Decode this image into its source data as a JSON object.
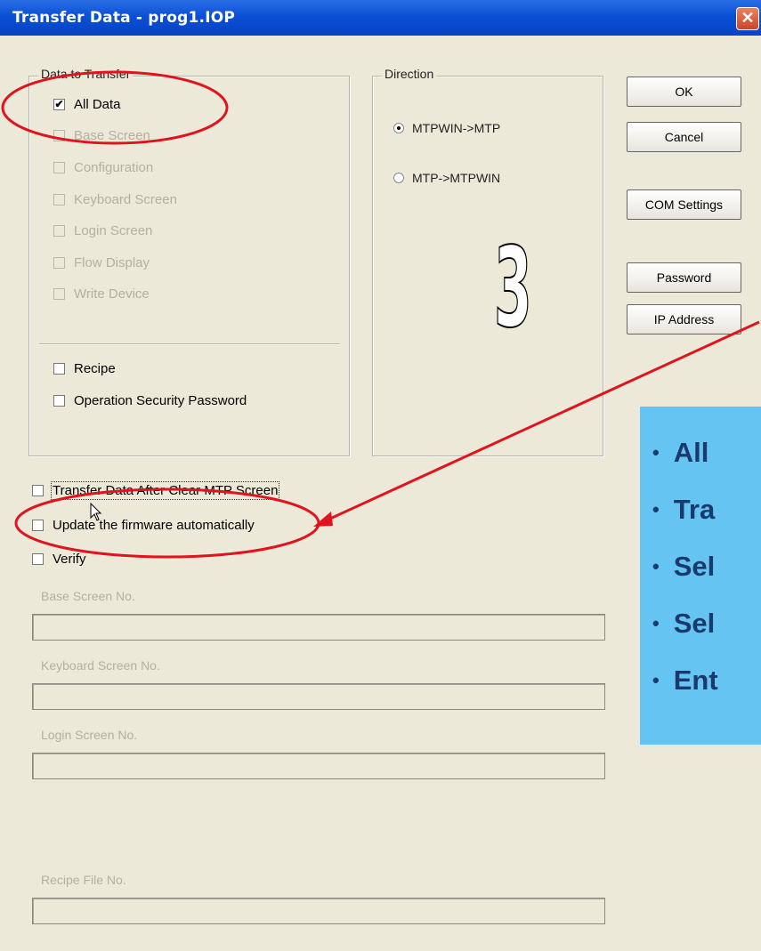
{
  "window": {
    "title": "Transfer Data - prog1.IOP",
    "close_icon": "close-icon"
  },
  "data_to_transfer": {
    "legend": "Data to Transfer",
    "items": [
      {
        "label": "All Data",
        "checked": true,
        "enabled": true
      },
      {
        "label": "Base Screen",
        "checked": true,
        "enabled": false
      },
      {
        "label": "Configuration",
        "checked": true,
        "enabled": false
      },
      {
        "label": "Keyboard Screen",
        "checked": true,
        "enabled": false
      },
      {
        "label": "Login Screen",
        "checked": true,
        "enabled": false
      },
      {
        "label": "Flow Display",
        "checked": true,
        "enabled": false
      },
      {
        "label": "Write Device",
        "checked": true,
        "enabled": false
      }
    ],
    "extra": [
      {
        "label": "Recipe",
        "checked": false
      },
      {
        "label": "Operation Security Password",
        "checked": false
      }
    ]
  },
  "direction": {
    "legend": "Direction",
    "options": [
      {
        "label": "MTPWIN->MTP",
        "selected": true
      },
      {
        "label": "MTP->MTPWIN",
        "selected": false
      }
    ]
  },
  "buttons": {
    "ok": "OK",
    "cancel": "Cancel",
    "com_settings": "COM Settings",
    "password": "Password",
    "ip_address": "IP Address"
  },
  "options": [
    {
      "label": "Transfer Data After Clear MTP Screen",
      "checked": false
    },
    {
      "label": "Update the firmware automatically",
      "checked": false
    },
    {
      "label": "Verify",
      "checked": false
    }
  ],
  "fields": [
    {
      "label": "Base Screen No.",
      "value": ""
    },
    {
      "label": "Keyboard Screen No.",
      "value": ""
    },
    {
      "label": "Login Screen No.",
      "value": ""
    },
    {
      "label": "Recipe File No.",
      "value": ""
    }
  ],
  "step_number": "3",
  "info_box": {
    "bullets": [
      "All",
      "Tra",
      "Sel",
      "Sel",
      "Ent"
    ]
  },
  "annotation_color": "#e0141e",
  "info_box_color": "#66c4f3"
}
